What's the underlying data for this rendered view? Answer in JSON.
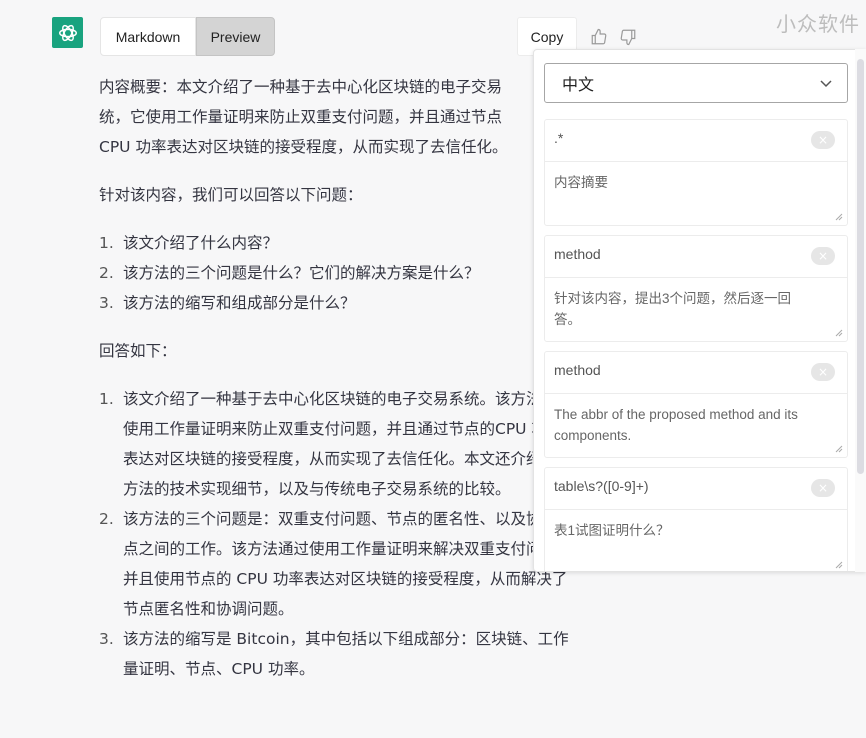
{
  "toolbar": {
    "logo": "chatgpt-logo",
    "view_tabs": [
      {
        "label": "Markdown",
        "active": false
      },
      {
        "label": "Preview",
        "active": true
      }
    ],
    "copy_label": "Copy",
    "thumbs_up": "thumbs-up-icon",
    "thumbs_down": "thumbs-down-icon",
    "watermark": "小众软件"
  },
  "content": {
    "summary": [
      "内容概要：本文介绍了一种基于去中心化区块链的电子交易",
      "统，它使用工作量证明来防止双重支付问题，并且通过节点",
      "CPU 功率表达对区块链的接受程度，从而实现了去信任化。"
    ],
    "questions_intro": "针对该内容，我们可以回答以下问题：",
    "questions": [
      {
        "num": "1.",
        "text": "该文介绍了什么内容？"
      },
      {
        "num": "2.",
        "text": "该方法的三个问题是什么？它们的解决方案是什么？"
      },
      {
        "num": "3.",
        "text": "该方法的缩写和组成部分是什么？"
      }
    ],
    "answers_intro": "回答如下：",
    "answers": [
      {
        "num": "1.",
        "text": "该文介绍了一种基于去中心化区块链的电子交易系统。该方法通过使用工作量证明来防止双重支付问题，并且通过节点的CPU 功率表达对区块链的接受程度，从而实现了去信任化。本文还介绍了该方法的技术实现细节，以及与传统电子交易系统的比较。"
      },
      {
        "num": "2.",
        "text": "该方法的三个问题是：双重支付问题、节点的匿名性、以及协调节点之间的工作。该方法通过使用工作量证明来解决双重支付问题，并且使用节点的 CPU 功率表达对区块链的接受程度，从而解决了节点匿名性和协调问题。"
      },
      {
        "num": "3.",
        "text": "该方法的缩写是 Bitcoin，其中包括以下组成部分：区块链、工作量证明、节点、CPU 功率。"
      }
    ]
  },
  "panel": {
    "language_select": {
      "value": "中文"
    },
    "rules": [
      {
        "pattern": ".*",
        "prompt": "内容摘要"
      },
      {
        "pattern": "method",
        "prompt": "针对该内容，提出3个问题，然后逐一回答。"
      },
      {
        "pattern": "method",
        "prompt": "The abbr of the proposed method and its components."
      },
      {
        "pattern": "table\\s?([0-9]+)",
        "prompt": "表1试图证明什么？"
      }
    ],
    "clear_glyph": "×"
  }
}
